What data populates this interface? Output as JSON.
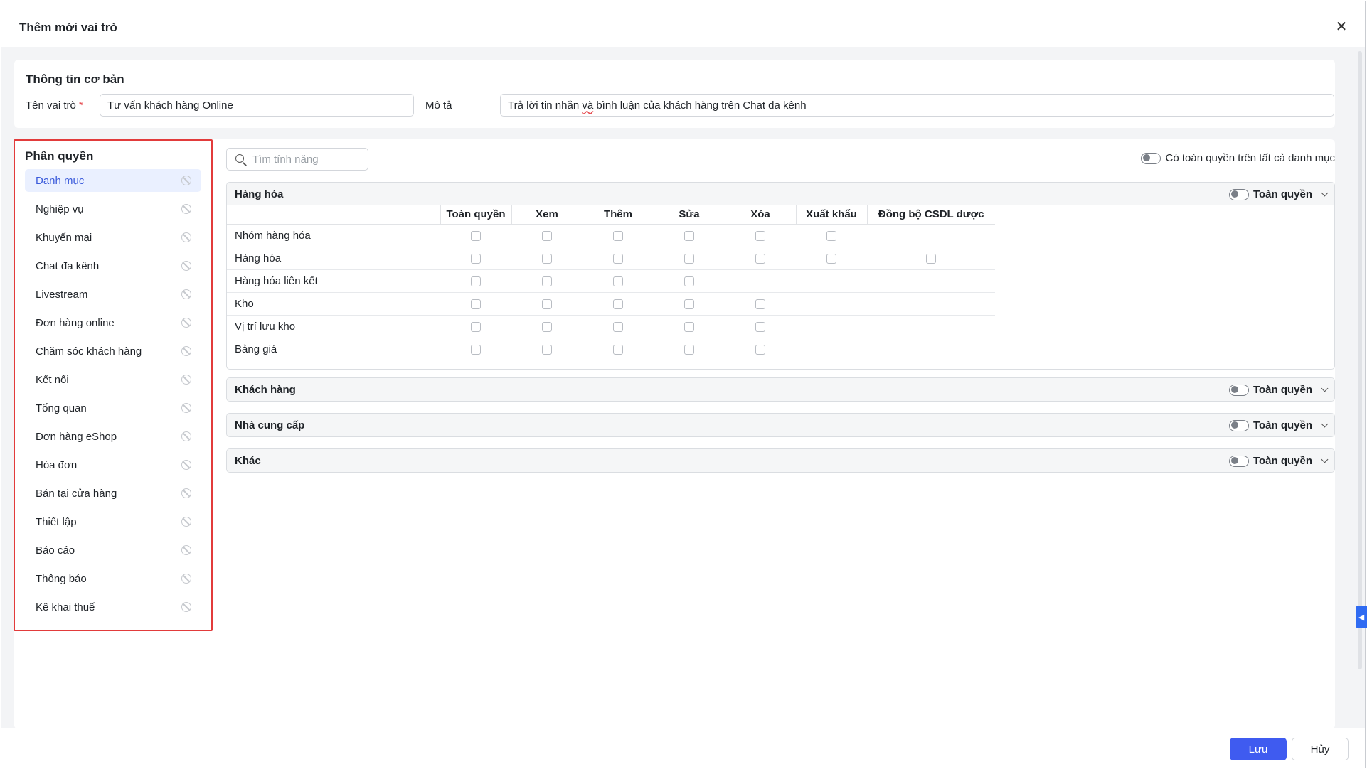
{
  "dialog": {
    "title": "Thêm mới vai trò",
    "close_icon": "close-icon"
  },
  "basic": {
    "title": "Thông tin cơ bản",
    "role_label": "Tên vai trò",
    "required_mark": "*",
    "role_value": "Tư vấn khách hàng Online",
    "desc_label": "Mô tả",
    "desc_value_pre": "Trả lời tin nhắn ",
    "desc_value_mis": "và",
    "desc_value_post": " bình luận của khách hàng trên Chat đa kênh"
  },
  "permissions": {
    "title": "Phân quyền",
    "search_placeholder": "Tìm tính năng",
    "all_toggle_label": "Có toàn quyền trên tất cả danh mục",
    "sidebar_items": [
      {
        "label": "Danh mục",
        "active": true
      },
      {
        "label": "Nghiệp vụ"
      },
      {
        "label": "Khuyến mại"
      },
      {
        "label": "Chat đa kênh"
      },
      {
        "label": "Livestream"
      },
      {
        "label": "Đơn hàng online"
      },
      {
        "label": "Chăm sóc khách hàng"
      },
      {
        "label": "Kết nối"
      },
      {
        "label": "Tổng quan"
      },
      {
        "label": "Đơn hàng eShop"
      },
      {
        "label": "Hóa đơn"
      },
      {
        "label": "Bán tại cửa hàng"
      },
      {
        "label": "Thiết lập"
      },
      {
        "label": "Báo cáo"
      },
      {
        "label": "Thông báo"
      },
      {
        "label": "Kê khai thuế"
      }
    ],
    "full_label": "Toàn quyền",
    "sections": [
      {
        "title": "Hàng hóa",
        "expanded": true,
        "columns": [
          "Toàn quyền",
          "Xem",
          "Thêm",
          "Sửa",
          "Xóa",
          "Xuất khẩu",
          "Đồng bộ CSDL dược"
        ],
        "rows": [
          {
            "name": "Nhóm hàng hóa",
            "cols": 6
          },
          {
            "name": "Hàng hóa",
            "cols": 7
          },
          {
            "name": "Hàng hóa liên kết",
            "cols": 4
          },
          {
            "name": "Kho",
            "cols": 5
          },
          {
            "name": "Vị trí lưu kho",
            "cols": 5
          },
          {
            "name": "Bảng giá",
            "cols": 5
          }
        ]
      },
      {
        "title": "Khách hàng",
        "expanded": false
      },
      {
        "title": "Nhà cung cấp",
        "expanded": false
      },
      {
        "title": "Khác",
        "expanded": false
      }
    ]
  },
  "footer": {
    "save_label": "Lưu",
    "cancel_label": "Hủy"
  },
  "colors": {
    "primary": "#3f5bf0",
    "highlight_border": "#e23b3b",
    "active_bg": "#eaf0ff"
  }
}
